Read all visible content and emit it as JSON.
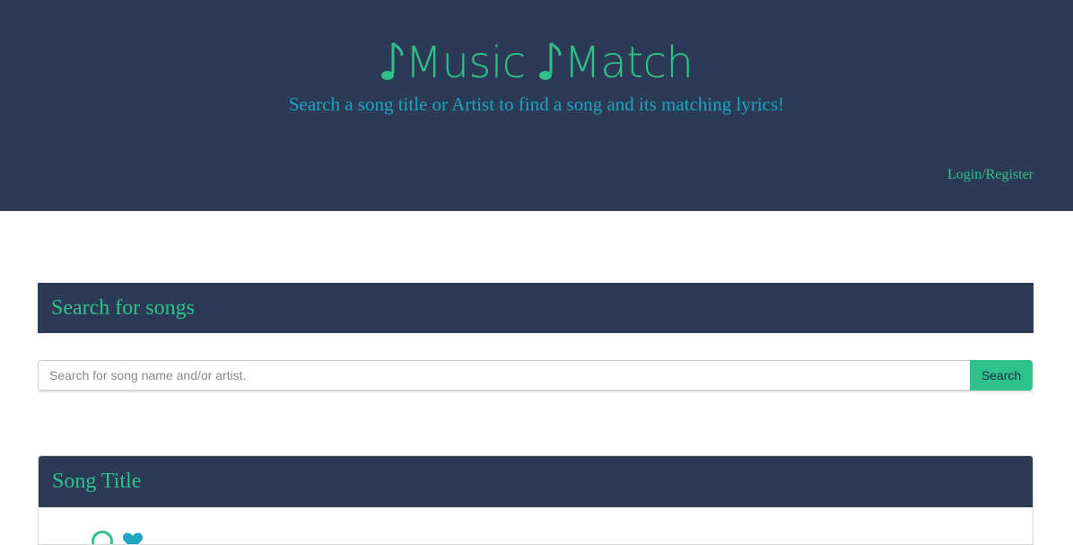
{
  "header": {
    "brand_word_1": "Music",
    "brand_word_2": "Match",
    "tagline": "Search a song title or Artist to find a song and its matching lyrics!",
    "login_label": "Login/Register"
  },
  "search": {
    "section_title": "Search for songs",
    "placeholder": "Search for song name and/or artist.",
    "value": "",
    "button_label": "Search"
  },
  "song_card": {
    "title": "Song Title",
    "icons": [
      "play-circle-icon",
      "heart-icon"
    ]
  },
  "colors": {
    "navy": "#2b3a55",
    "green": "#2fc18c",
    "teal": "#1fa5bf"
  }
}
